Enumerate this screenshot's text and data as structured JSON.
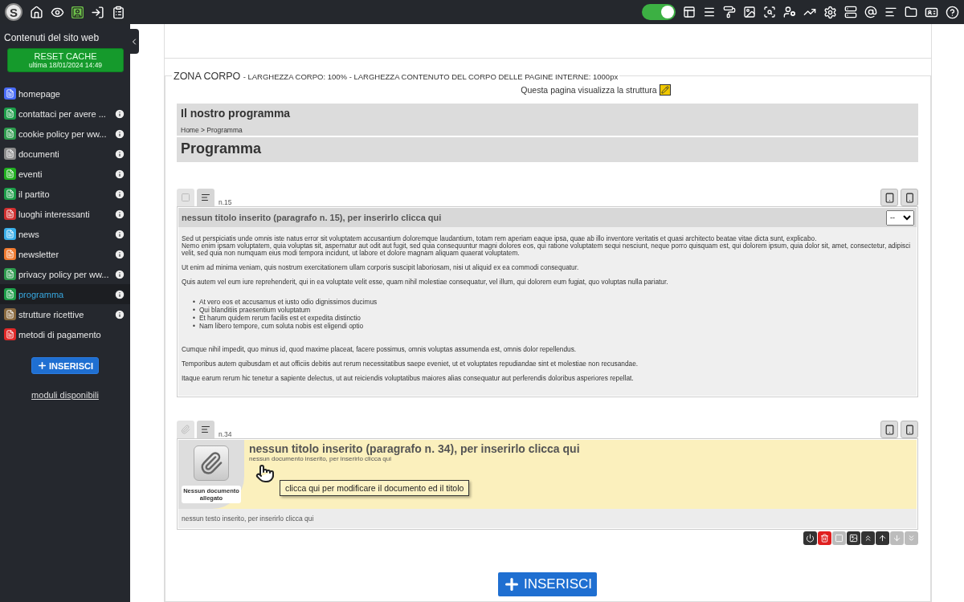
{
  "topbar": {
    "logo": "S",
    "toggle": {
      "on": true
    }
  },
  "sidebar": {
    "title": "Contenuti del sito web",
    "reset": {
      "label": "RESET CACHE",
      "sub": "ultima 18/01/2024 14:49"
    },
    "items": [
      {
        "label": "homepage",
        "color": "#4a6cf7",
        "info": false,
        "selected": false
      },
      {
        "label": "contattaci per avere ...",
        "color": "#1e9e4a",
        "info": true,
        "selected": false
      },
      {
        "label": "cookie policy per ww...",
        "color": "#2e9b4e",
        "info": true,
        "selected": false
      },
      {
        "label": "documenti",
        "color": "#8a8a8a",
        "info": true,
        "selected": false
      },
      {
        "label": "eventi",
        "color": "#22b022",
        "info": true,
        "selected": false
      },
      {
        "label": "il partito",
        "color": "#1e9e4a",
        "info": true,
        "selected": false
      },
      {
        "label": "luoghi interessanti",
        "color": "#d03030",
        "info": true,
        "selected": false
      },
      {
        "label": "news",
        "color": "#3aaee8",
        "info": true,
        "selected": false
      },
      {
        "label": "newsletter",
        "color": "#f07a30",
        "info": true,
        "selected": false
      },
      {
        "label": "privacy policy per ww...",
        "color": "#2e9b4e",
        "info": true,
        "selected": false
      },
      {
        "label": "programma",
        "color": "#1e9e4a",
        "info": true,
        "selected": true
      },
      {
        "label": "strutture ricettive",
        "color": "#8a6a40",
        "info": true,
        "selected": false
      },
      {
        "label": "metodi di pagamento",
        "color": "#e02828",
        "info": false,
        "selected": false
      }
    ],
    "insert": "INSERISCI",
    "modules": "moduli disponibili"
  },
  "zone": {
    "title": "ZONA CORPO",
    "subtitle": "- LARGHEZZA CORPO: 100% - LARGHEZZA CONTENUTO DEL CORPO DELLE PAGINE INTERNE: 1000px",
    "structure_note": "Questa pagina visualizza la struttura"
  },
  "page_header": {
    "title": "Il nostro programma",
    "breadcrumb": "Home > Programma",
    "heading": "Programma"
  },
  "block1": {
    "number": "n.15",
    "title": "nessun titolo inserito (paragrafo n. 15), per inserirlo clicca qui",
    "select": "--",
    "body": [
      {
        "kind": "paragraph",
        "lines": [
          "Sed ut perspiciatis unde omnis iste natus error sit voluptatem accusantium doloremque laudantium, totam rem aperiam eaque ipsa, quae ab illo inventore veritatis et quasi architecto beatae vitae dicta sunt, explicabo.",
          "Nemo enim ipsam voluptatem, quia voluptas sit, aspernatur aut odit aut fugit, sed quia consequuntur magni dolores eos, qui ratione voluptatem sequi nesciunt, neque porro quisquam est, qui dolorem ipsum, quia dolor sit, amet, consectetur, adipisci velit, sed quia non numquam eius modi tempora incidunt, ut labore et dolore magnam aliquam quaerat voluptatem."
        ]
      },
      {
        "kind": "paragraph",
        "lines": [
          "Ut enim ad minima veniam, quis nostrum exercitationem ullam corporis suscipit laboriosam, nisi ut aliquid ex ea commodi consequatur."
        ]
      },
      {
        "kind": "paragraph",
        "lines": [
          "Quis autem vel eum iure reprehenderit, qui in ea voluptate velit esse, quam nihil molestiae consequatur, vel illum, qui dolorem eum fugiat, quo voluptas nulla pariatur."
        ]
      },
      {
        "kind": "list",
        "marker": "•",
        "lines": [
          "At vero eos et accusamus et iusto odio dignissimos ducimus",
          "Qui blanditiis praesentium voluptatum",
          "Et harum quidem rerum facilis est et expedita distinctio",
          "Nam libero tempore, cum soluta nobis est eligendi optio"
        ]
      },
      {
        "kind": "paragraph",
        "lines": [
          "Cumque nihil impedit, quo minus id, quod maxime placeat, facere possimus, omnis voluptas assumenda est, omnis dolor repellendus."
        ]
      },
      {
        "kind": "paragraph",
        "lines": [
          "Temporibus autem quibusdam et aut officiis debitis aut rerum necessitatibus saepe eveniet, ut et voluptates repudiandae sint et molestiae non recusandae."
        ]
      },
      {
        "kind": "paragraph",
        "lines": [
          "Itaque earum rerum hic tenetur a sapiente delectus, ut aut reiciendis voluptatibus maiores alias consequatur aut perferendis doloribus asperiores repellat."
        ]
      }
    ]
  },
  "block2": {
    "number": "n.34",
    "doc_label": "Nessun documento allegato",
    "title": "nessun titolo inserito (paragrafo n. 34), per inserirlo clicca qui",
    "doc_hint": "nessun documento inserito, per inserirlo clicca qui",
    "tooltip": "clicca qui per modificare il documento ed il titolo",
    "text_hint": "nessun testo inserito, per inserirlo clicca qui",
    "actions": [
      {
        "kind": "power",
        "disabled": false
      },
      {
        "kind": "delete",
        "disabled": false
      },
      {
        "kind": "blank",
        "disabled": true
      },
      {
        "kind": "image",
        "disabled": false
      },
      {
        "kind": "top",
        "disabled": false
      },
      {
        "kind": "up",
        "disabled": false
      },
      {
        "kind": "down",
        "disabled": true
      },
      {
        "kind": "bottom",
        "disabled": true
      }
    ]
  },
  "insert_button": "INSERISCI"
}
